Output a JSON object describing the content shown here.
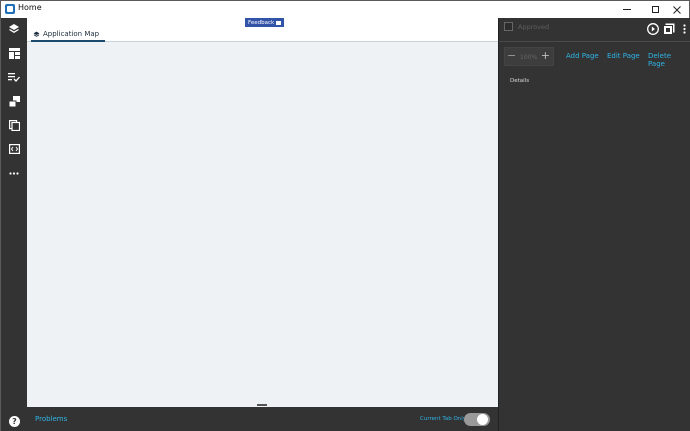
{
  "window": {
    "title": "Home",
    "controls": {
      "minimize": "—",
      "maximize": "☐",
      "close": "✕"
    }
  },
  "sidebar": {
    "icons": [
      "layers-icon",
      "table-layout-icon",
      "checklist-icon",
      "transfer-icon",
      "copy-pages-icon",
      "code-icon",
      "more-icon"
    ],
    "help_label": "?"
  },
  "main": {
    "tabs": [
      {
        "label": "Application Map",
        "icon": "layers-icon",
        "active": true
      }
    ],
    "feedback_label": "Feedback"
  },
  "bottombar": {
    "problems_label": "Problems",
    "current_tab_only_label": "Current Tab Only",
    "current_tab_only_enabled": true
  },
  "rightpanel": {
    "approved_label": "Approved",
    "approved_checked": false,
    "zoom_value": "100%",
    "zoom_minus": "−",
    "zoom_plus": "+",
    "actions": {
      "add_page": "Add Page",
      "edit_page": "Edit Page",
      "delete_page": "Delete Page"
    },
    "details_label": "Details"
  },
  "colors": {
    "sidebar_bg": "#333333",
    "canvas_bg": "#eef2f5",
    "accent_link": "#2fb4e6",
    "feedback_bg": "#3153a8",
    "tab_underline": "#1a4b6e"
  }
}
